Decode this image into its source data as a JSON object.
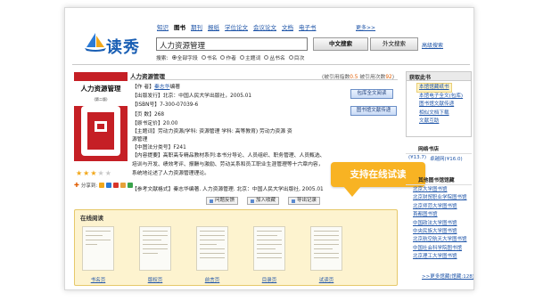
{
  "brand": {
    "name": "读秀"
  },
  "nav": {
    "items": [
      "知识",
      "图书",
      "期刊",
      "报纸",
      "学位论文",
      "会议论文",
      "文档",
      "电子书"
    ],
    "active_index": 1,
    "more": "更多>>"
  },
  "search": {
    "value": "人力资源管理",
    "zh_button": "中文搜索",
    "en_button": "外文搜索",
    "advanced": "高级搜索",
    "scope_label": "搜索:",
    "scopes": [
      "全部字段",
      "书名",
      "作者",
      "主题词",
      "丛书名",
      "目次"
    ],
    "selected_scope": 0
  },
  "book": {
    "title": "人力资源管理",
    "stats_prefix": "(被引用指数",
    "cite_index": "0.5",
    "stats_mid": " 被引用次数",
    "cite_count": "92",
    "stats_suffix": ")",
    "author_label": "【作 者】",
    "author_name": "秦志华",
    "author_suffix": "编著",
    "publisher": "【出版发行】北京：中国人民大学出版社，2005.01",
    "isbn": "【ISBN号】7-300-07039-6",
    "pages": "【页 数】268",
    "price": "【原书定价】20.00",
    "subject": "【主题词】劳动力资源/学科: 资源管理 学科: 高等教育) 劳动力资源 资源管理",
    "clc": "【中图法分类号】F241",
    "summary": "【内容提要】高职高专精品教材系列:本书分导论、人员组织、职务管理、人员甄选、培训与开发、绩效考评、报酬与激励、劳动关系和员工职业生涯管理等十六章内容，系统地论述了人力资源管理理论。",
    "reference": "【参考文献格式】秦志华编著. 人力资源管理. 北京：中国人民大学出版社, 2005.01",
    "cover_title": "人力资源管理",
    "cover_edition": "(第二版)",
    "rating": 3,
    "rating_max": 5
  },
  "actions": {
    "read_full": "包库全文阅读",
    "doc_delivery": "图书馆文献传递",
    "feedback": "问题反馈",
    "favorite": "加入收藏",
    "export": "导出记录"
  },
  "share": {
    "label": "分享到:"
  },
  "online_read": {
    "title": "在线阅读",
    "pages": [
      "书名页",
      "版权页",
      "前言页",
      "目录页",
      "试读页"
    ]
  },
  "callout": {
    "text": "支持在线试读"
  },
  "right_panel": {
    "title": "获取此书",
    "links": [
      "本馆馆藏纸书",
      "本馆电子全文(包库)",
      "图书馆文献传递",
      "相似文档下载",
      "文献互助"
    ],
    "shop_title": "网络书店",
    "shop_items": [
      "(¥13.7)",
      "卓越网(¥16.0)"
    ],
    "libs_title": "其他图书馆馆藏",
    "libs": [
      "北京大学图书馆",
      "北京财贸职业学院图书馆",
      "北京师范大学图书馆",
      "首都图书馆",
      "中国政法大学图书馆",
      "中央民族大学图书馆",
      "北京航空航天大学图书馆",
      "中国社会科学院图书馆",
      "北京理工大学图书馆"
    ],
    "libs_more": ">>更多馆藏(馆藏:128)"
  },
  "colors": {
    "accent": "#1f55a8",
    "highlight": "#f8b323",
    "cover": "#c51f25",
    "panel_bg": "#fdf3cf"
  }
}
